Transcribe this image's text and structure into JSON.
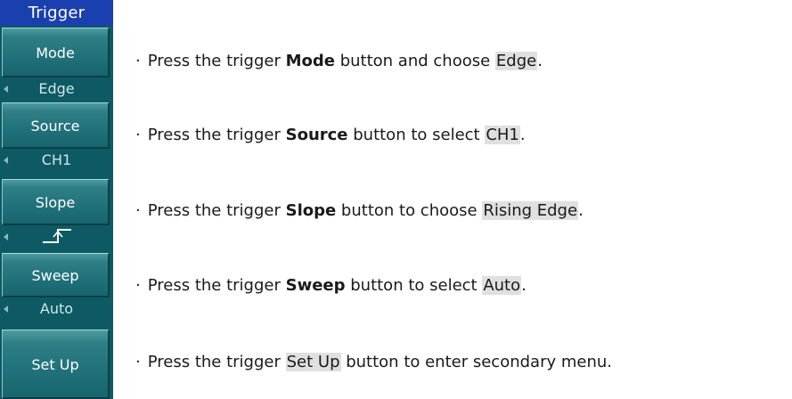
{
  "menu": {
    "title": "Trigger",
    "items": [
      {
        "label": "Mode",
        "value": "Edge"
      },
      {
        "label": "Source",
        "value": "CH1"
      },
      {
        "label": "Slope",
        "value_icon": "rising-edge-icon"
      },
      {
        "label": "Sweep",
        "value": "Auto"
      },
      {
        "label": "Set Up"
      }
    ]
  },
  "instructions": [
    {
      "bullet": "·",
      "prefix": "Press the trigger ",
      "button": "Mode",
      "middle": " button and choose ",
      "option": "Edge",
      "suffix": "."
    },
    {
      "bullet": "·",
      "prefix": "Press the trigger ",
      "button": "Source",
      "middle": " button to select ",
      "option": "CH1",
      "suffix": "."
    },
    {
      "bullet": "·",
      "prefix": "Press the trigger ",
      "button": "Slope",
      "middle": " button to choose ",
      "option": "Rising Edge",
      "suffix": "."
    },
    {
      "bullet": "·",
      "prefix": "Press the trigger ",
      "button": "Sweep",
      "middle": " button to select ",
      "option": "Auto",
      "suffix": "."
    },
    {
      "bullet": "·",
      "prefix": "Press the trigger ",
      "button": "Set Up",
      "middle": " button to enter secondary menu.",
      "option": "",
      "suffix": ""
    }
  ],
  "colors": {
    "menu_background": "#0d5a64",
    "title_bar": "#1a3fae",
    "highlight": "#e0e0e0"
  }
}
